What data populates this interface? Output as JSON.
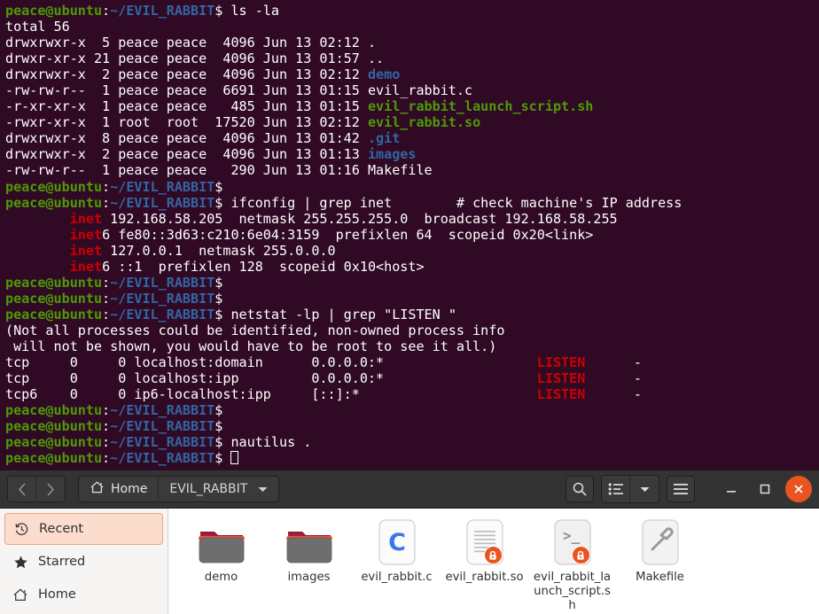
{
  "terminal": {
    "prompt": {
      "user": "peace@ubuntu",
      "colon": ":",
      "path": "~/EVIL_RABBIT",
      "dollar": "$"
    },
    "commands": {
      "ls": "ls -la",
      "ifconfig": "ifconfig | grep inet",
      "ifconfig_comment": "# check machine's IP address",
      "netstat": "netstat -lp | grep \"LISTEN \"",
      "nautilus": "nautilus ."
    },
    "ls_output": {
      "total": "total 56",
      "rows": [
        {
          "perms": "drwxrwxr-x",
          "links": " 5",
          "user": "peace",
          "group": "peace",
          "size": " 4096",
          "date": "Jun 13 02:12",
          "name": ".",
          "kind": "dir-plain"
        },
        {
          "perms": "drwxr-xr-x",
          "links": "21",
          "user": "peace",
          "group": "peace",
          "size": " 4096",
          "date": "Jun 13 01:57",
          "name": "..",
          "kind": "dir-plain"
        },
        {
          "perms": "drwxrwxr-x",
          "links": " 2",
          "user": "peace",
          "group": "peace",
          "size": " 4096",
          "date": "Jun 13 02:12",
          "name": "demo",
          "kind": "dir"
        },
        {
          "perms": "-rw-rw-r--",
          "links": " 1",
          "user": "peace",
          "group": "peace",
          "size": " 6691",
          "date": "Jun 13 01:15",
          "name": "evil_rabbit.c",
          "kind": "file"
        },
        {
          "perms": "-r-xr-xr-x",
          "links": " 1",
          "user": "peace",
          "group": "peace",
          "size": "  485",
          "date": "Jun 13 01:15",
          "name": "evil_rabbit_launch_script.sh",
          "kind": "exec"
        },
        {
          "perms": "-rwxr-xr-x",
          "links": " 1",
          "user": "root ",
          "group": "root ",
          "size": "17520",
          "date": "Jun 13 02:12",
          "name": "evil_rabbit.so",
          "kind": "exec"
        },
        {
          "perms": "drwxrwxr-x",
          "links": " 8",
          "user": "peace",
          "group": "peace",
          "size": " 4096",
          "date": "Jun 13 01:42",
          "name": ".git",
          "kind": "dir"
        },
        {
          "perms": "drwxrwxr-x",
          "links": " 2",
          "user": "peace",
          "group": "peace",
          "size": " 4096",
          "date": "Jun 13 01:13",
          "name": "images",
          "kind": "dir"
        },
        {
          "perms": "-rw-rw-r--",
          "links": " 1",
          "user": "peace",
          "group": "peace",
          "size": "  290",
          "date": "Jun 13 01:16",
          "name": "Makefile",
          "kind": "file"
        }
      ]
    },
    "ifconfig_output": [
      {
        "match": "inet",
        "rest": " 192.168.58.205  netmask 255.255.255.0  broadcast 192.168.58.255"
      },
      {
        "match": "inet",
        "rest": "6 fe80::3d63:c210:6e04:3159  prefixlen 64  scopeid 0x20<link>"
      },
      {
        "match": "inet",
        "rest": " 127.0.0.1  netmask 255.0.0.0"
      },
      {
        "match": "inet",
        "rest": "6 ::1  prefixlen 128  scopeid 0x10<host>"
      }
    ],
    "netstat_output": {
      "notice1": "(Not all processes could be identified, non-owned process info",
      "notice2": " will not be shown, you would have to be root to see it all.)",
      "rows": [
        {
          "proto": "tcp   ",
          "recvq": "  0",
          "sendq": "     0",
          "local": "localhost:domain      ",
          "foreign": "0.0.0.0:*             ",
          "state": "LISTEN",
          "pid": "-"
        },
        {
          "proto": "tcp   ",
          "recvq": "  0",
          "sendq": "     0",
          "local": "localhost:ipp         ",
          "foreign": "0.0.0.0:*             ",
          "state": "LISTEN",
          "pid": "-"
        },
        {
          "proto": "tcp6  ",
          "recvq": "  0",
          "sendq": "     0",
          "local": "ip6-localhost:ipp     ",
          "foreign": "[::]:*                ",
          "state": "LISTEN",
          "pid": "-"
        }
      ]
    },
    "colors": {
      "background": "#300a24",
      "user_green": "#4e9a06",
      "path_blue": "#3465a4",
      "match_red": "#cc0000",
      "text_white": "#ffffff"
    }
  },
  "nautilus": {
    "nav": {
      "back": "back-arrow",
      "forward": "forward-arrow"
    },
    "breadcrumb": [
      {
        "icon": "home-icon",
        "label": "Home"
      },
      {
        "icon": "",
        "label": "EVIL_RABBIT",
        "dropdown": true
      }
    ],
    "toolbar": {
      "search": "search-icon",
      "view_list": "list-view-icon",
      "view_dropdown": "chevron-down-icon",
      "menu": "hamburger-menu-icon"
    },
    "window_controls": {
      "minimize": "–",
      "maximize": "□",
      "close": "×",
      "close_color": "#e95420"
    },
    "sidebar": {
      "items": [
        {
          "label": "Recent",
          "icon": "clock-icon",
          "selected": true
        },
        {
          "label": "Starred",
          "icon": "star-icon",
          "selected": false
        },
        {
          "label": "Home",
          "icon": "home-icon",
          "selected": false
        }
      ],
      "selected_bg": "#fbdccd"
    },
    "files": [
      {
        "name": "demo",
        "type": "folder",
        "icon": "folder-icon",
        "locked": false
      },
      {
        "name": "images",
        "type": "folder",
        "icon": "folder-icon",
        "locked": false
      },
      {
        "name": "evil_rabbit.c",
        "type": "c-source",
        "icon": "c-file-icon",
        "locked": false
      },
      {
        "name": "evil_rabbit.so",
        "type": "shared-object",
        "icon": "document-icon",
        "locked": true
      },
      {
        "name": "evil_rabbit_launch_script.sh",
        "type": "shell-script",
        "icon": "script-icon",
        "locked": true
      },
      {
        "name": "Makefile",
        "type": "makefile",
        "icon": "hammer-icon",
        "locked": false
      }
    ],
    "colors": {
      "headerbar": "#333333",
      "sidebar": "#f6f5f4",
      "content": "#ffffff",
      "accent": "#e95420"
    }
  }
}
